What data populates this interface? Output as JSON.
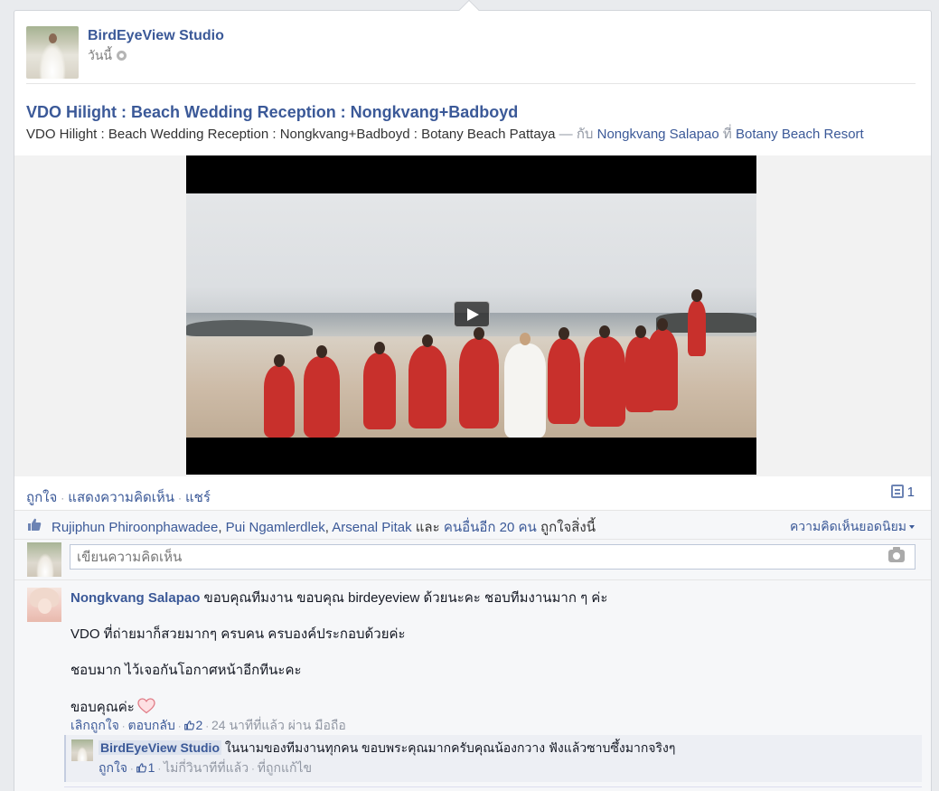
{
  "post": {
    "page_name": "BirdEyeView Studio",
    "time": "วันนี้",
    "title": "VDO Hilight : Beach Wedding Reception : Nongkvang+Badboyd",
    "subtitle_text": "VDO Hilight : Beach Wedding Reception : Nongkvang+Badboyd : Botany Beach Pattaya",
    "with_sep": "— กับ",
    "tagged_person": "Nongkvang Salapao",
    "at_word": "ที่",
    "location": "Botany Beach Resort"
  },
  "actions": {
    "like": "ถูกใจ",
    "comment": "แสดงความคิดเห็น",
    "share": "แชร์",
    "comment_count": "1"
  },
  "likes": {
    "person1": "Rujiphun Phiroonphawadee",
    "sep": ",",
    "person2": "Pui Ngamlerdlek",
    "person3": "Arsenal Pitak",
    "and_word": "และ",
    "others": "คนอื่นอีก 20 คน",
    "suffix": "ถูกใจสิ่งนี้",
    "top_comments": "ความคิดเห็นยอดนิยม"
  },
  "composer": {
    "placeholder": "เขียนความคิดเห็น"
  },
  "comment": {
    "author": "Nongkvang Salapao",
    "line1": "ขอบคุณทีมงาน ขอบคุณ birdeyeview ด้วยนะคะ ชอบทีมงานมาก ๆ ค่ะ",
    "line2": "VDO ที่ถ่ายมาก็สวยมากๆ ครบคน ครบองค์ประกอบด้วยค่ะ",
    "line3": "ชอบมาก ไว้เจอกันโอกาศหน้าอีกทีนะคะ",
    "line4": "ขอบคุณค่ะ",
    "unlike": "เลิกถูกใจ",
    "reply": "ตอบกลับ",
    "like_count": "2",
    "time": "24 นาทีที่แล้ว",
    "via": "ผ่าน มือถือ"
  },
  "reply": {
    "author": "BirdEyeView Studio",
    "text": "ในนามของทีมงานทุกคน ขอบพระคุณมากครับคุณน้องกวาง ฟังแล้วซาบซึ้งมากจริงๆ",
    "like": "ถูกใจ",
    "like_count": "1",
    "time": "ไม่กี่วินาทีที่แล้ว",
    "edit": "ที่ถูกแก้ไข"
  },
  "colors": {
    "link": "#3b5998",
    "dress": "#c8302c"
  }
}
